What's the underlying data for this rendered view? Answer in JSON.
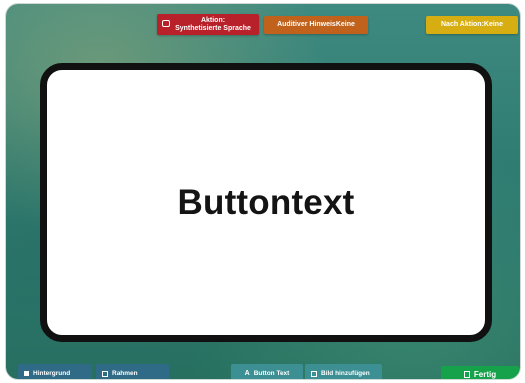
{
  "top_bar": {
    "action_button": "Aktion:\nSynthetisierte Sprache",
    "audio_hint_button": "Auditiver HinweisKeine",
    "after_action_button": "Nach Aktion:Keine"
  },
  "card": {
    "button_text": "Buttontext"
  },
  "bottom_bar": {
    "background_button": "Hintergrund",
    "frame_button": "Rahmen",
    "button_text_button": "Button Text",
    "button_text_icon": "A",
    "add_image_button": "Bild hinzufügen",
    "done_button": "Fertig"
  },
  "colors": {
    "action": "#b8202a",
    "audio_hint": "#c0621c",
    "after_action": "#d6ae12",
    "done": "#16a24a"
  }
}
